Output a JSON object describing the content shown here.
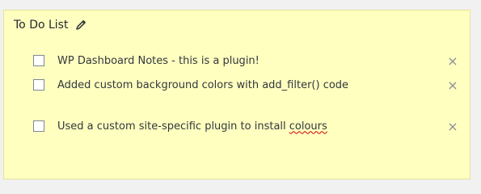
{
  "note": {
    "title": "To Do List",
    "items": [
      {
        "text": "WP Dashboard Notes - this is a plugin!",
        "checked": false
      },
      {
        "text": "Added custom background colors with add_filter() code",
        "checked": false
      },
      {
        "text_prefix": "Used a custom site-specific plugin to install ",
        "text_flagged": "colours",
        "checked": false
      }
    ],
    "delete_glyph": "×"
  },
  "colors": {
    "note_background": "#ffffc0",
    "page_background": "#f1f1f1"
  },
  "icons": {
    "edit": "pencil-icon",
    "delete": "close-icon"
  }
}
